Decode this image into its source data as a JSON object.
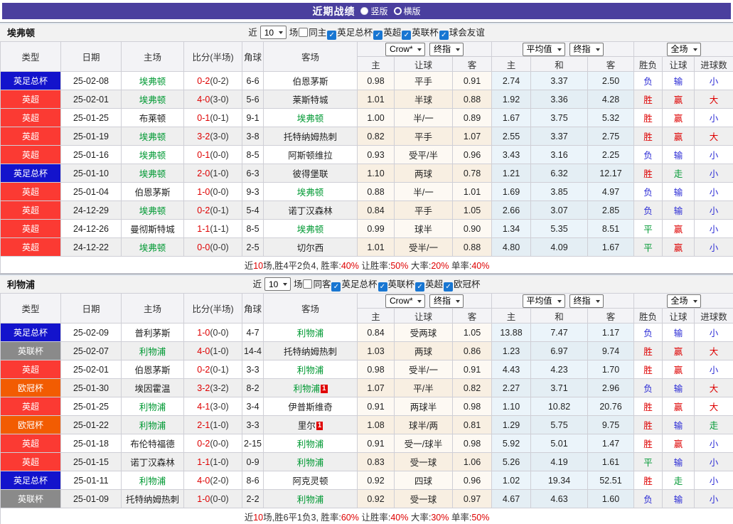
{
  "title": {
    "text": "近期战绩",
    "vertical_label": "竖版",
    "horizontal_label": "横版"
  },
  "colors": {
    "titlebar": "#4a3f9e",
    "win_red": "#de0000",
    "loss_blue": "#2b2bd5",
    "draw_green": "#009933",
    "team_highlight_green": "#009933",
    "score_red": "#de0000"
  },
  "type_colors": {
    "英足总杯": "#1313cc",
    "英超": "#fb3a33",
    "英联杯": "#8a8a8a",
    "欧冠杯": "#f25c02"
  },
  "result_colors": {
    "胜": "#de0000",
    "负": "#2b2bd5",
    "平": "#009933",
    "赢": "#de0000",
    "输": "#2b2bd5",
    "走": "#009933",
    "大": "#de0000",
    "小": "#2b2bd5"
  },
  "columns": {
    "type": "类型",
    "date": "日期",
    "home": "主场",
    "score": "比分(半场)",
    "corner": "角球",
    "away": "客场",
    "ah_home": "主",
    "ah_line": "让球",
    "ah_away": "客",
    "eu_home": "主",
    "eu_draw": "和",
    "eu_away": "客",
    "result": "胜负",
    "handicap": "让球",
    "goals": "进球数"
  },
  "table_selects": {
    "bookmaker": "Crow*",
    "final": "终指",
    "average": "平均值",
    "scope": "全场"
  },
  "sections": [
    {
      "team": "埃弗顿",
      "filter": {
        "near_label": "近",
        "count_value": "10",
        "unit_label": "场",
        "same_side_label": "同主",
        "same_side_checked": false,
        "competitions": [
          {
            "label": "英足总杯",
            "checked": true
          },
          {
            "label": "英超",
            "checked": true
          },
          {
            "label": "英联杯",
            "checked": true
          },
          {
            "label": "球会友谊",
            "checked": true
          }
        ]
      },
      "rows": [
        {
          "type": "英足总杯",
          "date": "25-02-08",
          "home": "埃弗顿",
          "hg": true,
          "score": "0-2",
          "half": "(0-2)",
          "corner": "6-6",
          "away": "伯恩茅斯",
          "ag": false,
          "ah": [
            "0.98",
            "平手",
            "0.91"
          ],
          "eu": [
            "2.74",
            "3.37",
            "2.50"
          ],
          "res": [
            "负",
            "输",
            "小"
          ]
        },
        {
          "type": "英超",
          "date": "25-02-01",
          "home": "埃弗顿",
          "hg": true,
          "score": "4-0",
          "half": "(3-0)",
          "corner": "5-6",
          "away": "莱斯特城",
          "ag": false,
          "ah": [
            "1.01",
            "半球",
            "0.88"
          ],
          "eu": [
            "1.92",
            "3.36",
            "4.28"
          ],
          "res": [
            "胜",
            "赢",
            "大"
          ]
        },
        {
          "type": "英超",
          "date": "25-01-25",
          "home": "布莱顿",
          "hg": false,
          "score": "0-1",
          "half": "(0-1)",
          "corner": "9-1",
          "away": "埃弗顿",
          "ag": true,
          "ah": [
            "1.00",
            "半/一",
            "0.89"
          ],
          "eu": [
            "1.67",
            "3.75",
            "5.32"
          ],
          "res": [
            "胜",
            "赢",
            "小"
          ]
        },
        {
          "type": "英超",
          "date": "25-01-19",
          "home": "埃弗顿",
          "hg": true,
          "score": "3-2",
          "half": "(3-0)",
          "corner": "3-8",
          "away": "托特纳姆热刺",
          "ag": false,
          "ah": [
            "0.82",
            "平手",
            "1.07"
          ],
          "eu": [
            "2.55",
            "3.37",
            "2.75"
          ],
          "res": [
            "胜",
            "赢",
            "大"
          ]
        },
        {
          "type": "英超",
          "date": "25-01-16",
          "home": "埃弗顿",
          "hg": true,
          "score": "0-1",
          "half": "(0-0)",
          "corner": "8-5",
          "away": "阿斯顿维拉",
          "ag": false,
          "ah": [
            "0.93",
            "受平/半",
            "0.96"
          ],
          "eu": [
            "3.43",
            "3.16",
            "2.25"
          ],
          "res": [
            "负",
            "输",
            "小"
          ]
        },
        {
          "type": "英足总杯",
          "date": "25-01-10",
          "home": "埃弗顿",
          "hg": true,
          "score": "2-0",
          "half": "(1-0)",
          "corner": "6-3",
          "away": "彼得堡联",
          "ag": false,
          "ah": [
            "1.10",
            "两球",
            "0.78"
          ],
          "eu": [
            "1.21",
            "6.32",
            "12.17"
          ],
          "res": [
            "胜",
            "走",
            "小"
          ]
        },
        {
          "type": "英超",
          "date": "25-01-04",
          "home": "伯恩茅斯",
          "hg": false,
          "score": "1-0",
          "half": "(0-0)",
          "corner": "9-3",
          "away": "埃弗顿",
          "ag": true,
          "ah": [
            "0.88",
            "半/一",
            "1.01"
          ],
          "eu": [
            "1.69",
            "3.85",
            "4.97"
          ],
          "res": [
            "负",
            "输",
            "小"
          ]
        },
        {
          "type": "英超",
          "date": "24-12-29",
          "home": "埃弗顿",
          "hg": true,
          "score": "0-2",
          "half": "(0-1)",
          "corner": "5-4",
          "away": "诺丁汉森林",
          "ag": false,
          "ah": [
            "0.84",
            "平手",
            "1.05"
          ],
          "eu": [
            "2.66",
            "3.07",
            "2.85"
          ],
          "res": [
            "负",
            "输",
            "小"
          ]
        },
        {
          "type": "英超",
          "date": "24-12-26",
          "home": "曼彻斯特城",
          "hg": false,
          "score": "1-1",
          "half": "(1-1)",
          "corner": "8-5",
          "away": "埃弗顿",
          "ag": true,
          "ah": [
            "0.99",
            "球半",
            "0.90"
          ],
          "eu": [
            "1.34",
            "5.35",
            "8.51"
          ],
          "res": [
            "平",
            "赢",
            "小"
          ]
        },
        {
          "type": "英超",
          "date": "24-12-22",
          "home": "埃弗顿",
          "hg": true,
          "score": "0-0",
          "half": "(0-0)",
          "corner": "2-5",
          "away": "切尔西",
          "ag": false,
          "ah": [
            "1.01",
            "受半/一",
            "0.88"
          ],
          "eu": [
            "4.80",
            "4.09",
            "1.67"
          ],
          "res": [
            "平",
            "赢",
            "小"
          ]
        }
      ],
      "summary": [
        [
          "近",
          0
        ],
        [
          "10",
          1
        ],
        [
          "场,胜4平2负4, 胜率:",
          0
        ],
        [
          "40%",
          1
        ],
        [
          " 让胜率:",
          0
        ],
        [
          "50%",
          1
        ],
        [
          " 大率:",
          0
        ],
        [
          "20%",
          1
        ],
        [
          " 单率:",
          0
        ],
        [
          "40%",
          1
        ]
      ]
    },
    {
      "team": "利物浦",
      "filter": {
        "near_label": "近",
        "count_value": "10",
        "unit_label": "场",
        "same_side_label": "同客",
        "same_side_checked": false,
        "competitions": [
          {
            "label": "英足总杯",
            "checked": true
          },
          {
            "label": "英联杯",
            "checked": true
          },
          {
            "label": "英超",
            "checked": true
          },
          {
            "label": "欧冠杯",
            "checked": true
          }
        ]
      },
      "rows": [
        {
          "type": "英足总杯",
          "date": "25-02-09",
          "home": "普利茅斯",
          "hg": false,
          "score": "1-0",
          "half": "(0-0)",
          "corner": "4-7",
          "away": "利物浦",
          "ag": true,
          "ah": [
            "0.84",
            "受两球",
            "1.05"
          ],
          "eu": [
            "13.88",
            "7.47",
            "1.17"
          ],
          "res": [
            "负",
            "输",
            "小"
          ]
        },
        {
          "type": "英联杯",
          "date": "25-02-07",
          "home": "利物浦",
          "hg": true,
          "score": "4-0",
          "half": "(1-0)",
          "corner": "14-4",
          "away": "托特纳姆热刺",
          "ag": false,
          "ah": [
            "1.03",
            "两球",
            "0.86"
          ],
          "eu": [
            "1.23",
            "6.97",
            "9.74"
          ],
          "res": [
            "胜",
            "赢",
            "大"
          ]
        },
        {
          "type": "英超",
          "date": "25-02-01",
          "home": "伯恩茅斯",
          "hg": false,
          "score": "0-2",
          "half": "(0-1)",
          "corner": "3-3",
          "away": "利物浦",
          "ag": true,
          "ah": [
            "0.98",
            "受半/一",
            "0.91"
          ],
          "eu": [
            "4.43",
            "4.23",
            "1.70"
          ],
          "res": [
            "胜",
            "赢",
            "小"
          ]
        },
        {
          "type": "欧冠杯",
          "date": "25-01-30",
          "home": "埃因霍温",
          "hg": false,
          "score": "3-2",
          "half": "(3-2)",
          "corner": "8-2",
          "away": "利物浦",
          "ag": true,
          "ab": "1",
          "ah": [
            "1.07",
            "平/半",
            "0.82"
          ],
          "eu": [
            "2.27",
            "3.71",
            "2.96"
          ],
          "res": [
            "负",
            "输",
            "大"
          ]
        },
        {
          "type": "英超",
          "date": "25-01-25",
          "home": "利物浦",
          "hg": true,
          "score": "4-1",
          "half": "(3-0)",
          "corner": "3-4",
          "away": "伊普斯维奇",
          "ag": false,
          "ah": [
            "0.91",
            "两球半",
            "0.98"
          ],
          "eu": [
            "1.10",
            "10.82",
            "20.76"
          ],
          "res": [
            "胜",
            "赢",
            "大"
          ]
        },
        {
          "type": "欧冠杯",
          "date": "25-01-22",
          "home": "利物浦",
          "hg": true,
          "score": "2-1",
          "half": "(1-0)",
          "corner": "3-3",
          "away": "里尔",
          "ag": false,
          "ab": "1",
          "ah": [
            "1.08",
            "球半/两",
            "0.81"
          ],
          "eu": [
            "1.29",
            "5.75",
            "9.75"
          ],
          "res": [
            "胜",
            "输",
            "走"
          ]
        },
        {
          "type": "英超",
          "date": "25-01-18",
          "home": "布伦特福德",
          "hg": false,
          "score": "0-2",
          "half": "(0-0)",
          "corner": "2-15",
          "away": "利物浦",
          "ag": true,
          "ah": [
            "0.91",
            "受一/球半",
            "0.98"
          ],
          "eu": [
            "5.92",
            "5.01",
            "1.47"
          ],
          "res": [
            "胜",
            "赢",
            "小"
          ]
        },
        {
          "type": "英超",
          "date": "25-01-15",
          "home": "诺丁汉森林",
          "hg": false,
          "score": "1-1",
          "half": "(1-0)",
          "corner": "0-9",
          "away": "利物浦",
          "ag": true,
          "ah": [
            "0.83",
            "受一球",
            "1.06"
          ],
          "eu": [
            "5.26",
            "4.19",
            "1.61"
          ],
          "res": [
            "平",
            "输",
            "小"
          ]
        },
        {
          "type": "英足总杯",
          "date": "25-01-11",
          "home": "利物浦",
          "hg": true,
          "score": "4-0",
          "half": "(2-0)",
          "corner": "8-6",
          "away": "阿克灵顿",
          "ag": false,
          "ah": [
            "0.92",
            "四球",
            "0.96"
          ],
          "eu": [
            "1.02",
            "19.34",
            "52.51"
          ],
          "res": [
            "胜",
            "走",
            "小"
          ]
        },
        {
          "type": "英联杯",
          "date": "25-01-09",
          "home": "托特纳姆热刺",
          "hg": false,
          "score": "1-0",
          "half": "(0-0)",
          "corner": "2-2",
          "away": "利物浦",
          "ag": true,
          "ah": [
            "0.92",
            "受一球",
            "0.97"
          ],
          "eu": [
            "4.67",
            "4.63",
            "1.60"
          ],
          "res": [
            "负",
            "输",
            "小"
          ]
        }
      ],
      "summary": [
        [
          "近",
          0
        ],
        [
          "10",
          1
        ],
        [
          "场,胜6平1负3, 胜率:",
          0
        ],
        [
          "60%",
          1
        ],
        [
          " 让胜率:",
          0
        ],
        [
          "40%",
          1
        ],
        [
          " 大率:",
          0
        ],
        [
          "30%",
          1
        ],
        [
          " 单率:",
          0
        ],
        [
          "50%",
          1
        ]
      ]
    }
  ]
}
